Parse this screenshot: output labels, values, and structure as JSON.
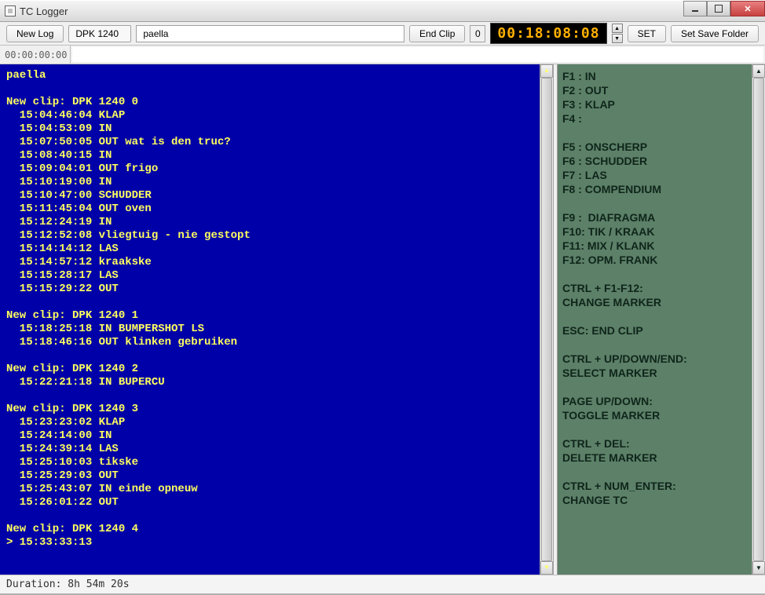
{
  "window": {
    "title": "TC Logger"
  },
  "toolbar": {
    "new_log": "New Log",
    "clip_id": "DPK 1240",
    "session_name": "paella",
    "end_clip": "End Clip",
    "count": "0",
    "timecode": "00:18:08:08",
    "set": "SET",
    "set_save_folder": "Set Save Folder"
  },
  "entry": {
    "tc": "00:00:00:00",
    "text": ""
  },
  "log_lines": [
    "paella",
    "",
    "New clip: DPK 1240 0",
    "  15:04:46:04 KLAP",
    "  15:04:53:09 IN",
    "  15:07:50:05 OUT wat is den truc?",
    "  15:08:40:15 IN",
    "  15:09:04:01 OUT frigo",
    "  15:10:19:00 IN",
    "  15:10:47:00 SCHUDDER",
    "  15:11:45:04 OUT oven",
    "  15:12:24:19 IN",
    "  15:12:52:08 vliegtuig - nie gestopt",
    "  15:14:14:12 LAS",
    "  15:14:57:12 kraakske",
    "  15:15:28:17 LAS",
    "  15:15:29:22 OUT",
    "",
    "New clip: DPK 1240 1",
    "  15:18:25:18 IN BUMPERSHOT LS",
    "  15:18:46:16 OUT klinken gebruiken",
    "",
    "New clip: DPK 1240 2",
    "  15:22:21:18 IN BUPERCU",
    "",
    "New clip: DPK 1240 3",
    "  15:23:23:02 KLAP",
    "  15:24:14:00 IN",
    "  15:24:39:14 LAS",
    "  15:25:10:03 tikske",
    "  15:25:29:03 OUT",
    "  15:25:43:07 IN einde opneuw",
    "  15:26:01:22 OUT",
    "",
    "New clip: DPK 1240 4",
    "> 15:33:33:13"
  ],
  "help_lines": [
    "F1 : IN",
    "F2 : OUT",
    "F3 : KLAP",
    "F4 :",
    "",
    "F5 : ONSCHERP",
    "F6 : SCHUDDER",
    "F7 : LAS",
    "F8 : COMPENDIUM",
    "",
    "F9 :  DIAFRAGMA",
    "F10: TIK / KRAAK",
    "F11: MIX / KLANK",
    "F12: OPM. FRANK",
    "",
    "CTRL + F1-F12:",
    "CHANGE MARKER",
    "",
    "ESC: END CLIP",
    "",
    "CTRL + UP/DOWN/END:",
    "SELECT MARKER",
    "",
    "PAGE UP/DOWN:",
    "TOGGLE MARKER",
    "",
    "CTRL + DEL:",
    "DELETE MARKER",
    "",
    "CTRL + NUM_ENTER:",
    "CHANGE TC"
  ],
  "status": {
    "duration": "Duration: 8h 54m 20s"
  }
}
